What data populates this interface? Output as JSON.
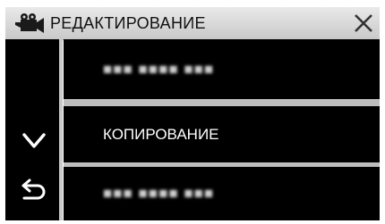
{
  "header": {
    "title": "РЕДАКТИРОВАНИЕ",
    "mode_icon": "video-camera-icon",
    "close_icon": "close-icon"
  },
  "side_panel": {
    "down_icon": "chevron-down-icon",
    "back_icon": "back-arrow-icon"
  },
  "menu": {
    "items": [
      {
        "label": "■■■ ■■■■ ■■■",
        "legible": false
      },
      {
        "label": "КОПИРОВАНИЕ",
        "legible": true
      },
      {
        "label": "■■■ ■■■■ ■■■",
        "legible": false
      }
    ]
  },
  "colors": {
    "title_bar": "#d6d6d6",
    "panel": "#000000",
    "separator": "#bdbdbd",
    "text_light": "#ffffff"
  }
}
